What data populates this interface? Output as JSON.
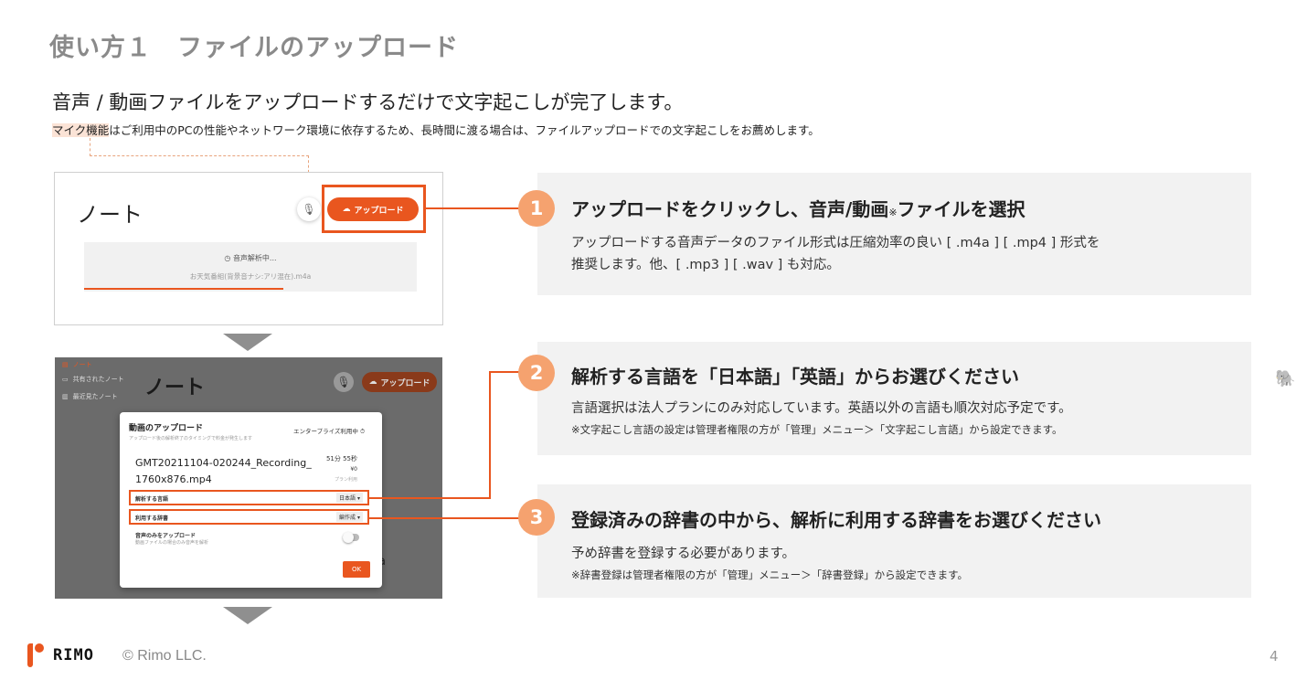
{
  "page_title": "使い方１　ファイルのアップロード",
  "subtitle": "音声 / 動画ファイルをアップロードするだけで文字起こしが完了します。",
  "note": {
    "highlight": "マイク機能",
    "rest": "はご利用中のPCの性能やネットワーク環境に依存するため、長時間に渡る場合は、ファイルアップロードでの文字起こしをお薦めします。"
  },
  "shot1": {
    "title": "ノート",
    "mic_icon": "mic-icon",
    "upload_label": "アップロード",
    "status": "音声解析中...",
    "file": "お天気番組(背景音ナシ:アリ混在).m4a",
    "progress": 0.6
  },
  "shot2": {
    "sidebar": [
      {
        "label": "ノート",
        "icon": "note-icon"
      },
      {
        "label": "共有されたノート",
        "icon": "shared-icon"
      },
      {
        "label": "最近見たノート",
        "icon": "recent-icon"
      }
    ],
    "title": "ノート",
    "upload_label": "アップロード",
    "modal": {
      "title": "動画のアップロード",
      "subtitle": "アップロード後の解析終了のタイミングで料金が発生します",
      "plan": "エンタープライズ利用中",
      "file_line1": "GMT20211104-020244_Recording_",
      "file_line2": "1760x876.mp4",
      "duration": "51分 55秒",
      "price": "¥0",
      "price_note": "プラン利用",
      "language_label": "解析する言語",
      "language_value": "日本語",
      "dict_label": "利用する辞書",
      "dict_value": "編作成",
      "audio_only_label": "音声のみをアップロード",
      "audio_only_sub": "動画ファイルの場合のみ音声を解析",
      "ok_label": "OK"
    }
  },
  "steps": [
    {
      "number": "1",
      "heading_a": "アップロードをクリックし、音声/動画",
      "heading_mark": "※",
      "heading_b": "ファイルを選択",
      "body1": "アップロードする音声データのファイル形式は圧縮効率の良い [ .m4a ] [ .mp4 ] 形式を",
      "body2": "推奨します。他、[ .mp3 ] [ .wav ] も対応。"
    },
    {
      "number": "2",
      "heading": "解析する言語を「日本語」「英語」からお選びください",
      "body": "言語選択は法人プランにのみ対応しています。英語以外の言語も順次対応予定です。",
      "note": "※文字起こし言語の設定は管理者権限の方が「管理」メニュー＞「文字起こし言語」から設定できます。"
    },
    {
      "number": "3",
      "heading": "登録済みの辞書の中から、解析に利用する辞書をお選びください",
      "body": "予め辞書を登録する必要があります。",
      "note": "※辞書登録は管理者権限の方が「管理」メニュー＞「辞書登録」から設定できます。"
    }
  ],
  "footer": {
    "logo": "RIMO",
    "copyright": "© Rimo LLC.",
    "page": "4"
  },
  "colors": {
    "accent": "#e9561f",
    "step_circle": "#f5a26f",
    "panel_bg": "#f2f2f2"
  }
}
